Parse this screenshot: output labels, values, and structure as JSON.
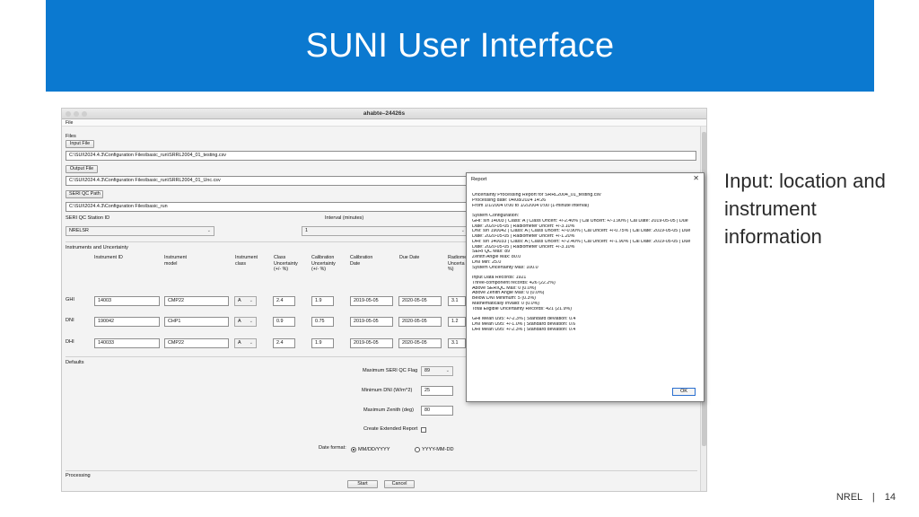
{
  "slide": {
    "title": "SUNI User Interface",
    "side_text": "Input: location and instrument information",
    "footer_org": "NREL",
    "footer_sep": "|",
    "footer_page": "14"
  },
  "app": {
    "window_title": "ahabte–24426s",
    "menu_file": "File",
    "files_section": "Files",
    "input_file_button": "Input File",
    "input_file_path": "C:\\SUI\\2024.4.3\\Configuration Files\\basic_run\\SRRL2004_01_testing.csv",
    "output_file_button": "Output File",
    "output_file_path": "C:\\SUI\\2024.4.3\\Configuration Files\\basic_run\\SRRL2004_01_Unc.csv",
    "seri_qc_path_button": "SERI QC Path",
    "seri_qc_path": "C:\\SUI\\2024.4.3\\Configuration Files\\basic_run",
    "station_label": "SERI QC Station ID",
    "station_value": "NRELSR",
    "interval_label": "Interval (minutes)",
    "interval_value": "1",
    "instruments_section": "Instruments and Uncertainty",
    "columns": {
      "id": "Instrument ID",
      "model_1": "Instrument",
      "model_2": "model",
      "class_1": "Instrument",
      "class_2": "class",
      "cu_1": "Class",
      "cu_2": "Uncertainty",
      "cu_3": "(+/- %)",
      "calu_1": "Calibration",
      "calu_2": "Uncertainty",
      "calu_3": "(+/- %)",
      "cald_1": "Calibration",
      "cald_2": "Date",
      "due": "Due Date",
      "rad_1": "Radiome",
      "rad_2": "Uncerta",
      "rad_3": "%)"
    },
    "rows": [
      {
        "label": "GHI",
        "id": "14003",
        "model": "CMP22",
        "class": "A",
        "class_unc": "2.4",
        "cal_unc": "1.9",
        "cal_date": "2019-05-05",
        "due_date": "2020-05-05",
        "radiometer": "3.1"
      },
      {
        "label": "DNI",
        "id": "190042",
        "model": "CHP1",
        "class": "A",
        "class_unc": "0.9",
        "cal_unc": "0.75",
        "cal_date": "2019-05-05",
        "due_date": "2020-05-05",
        "radiometer": "1.2"
      },
      {
        "label": "DHI",
        "id": "140033",
        "model": "CMP22",
        "class": "A",
        "class_unc": "2.4",
        "cal_unc": "1.9",
        "cal_date": "2019-05-05",
        "due_date": "2020-05-05",
        "radiometer": "3.1"
      }
    ],
    "defaults_section": "Defaults",
    "max_flag_label": "Maximum SERI QC Flag",
    "max_flag_value": "89",
    "min_dni_label": "Minimum DNI (W/m^2)",
    "min_dni_value": "25",
    "max_zenith_label": "Maximum Zenith (deg)",
    "max_zenith_value": "80",
    "extended_report_label": "Create Extended Report",
    "date_format_label": "Date format:",
    "date_format_option1": "MM/DD/YYYY",
    "date_format_option2": "YYYY-MM-DD",
    "processing_section": "Processing",
    "start_button": "Start",
    "cancel_button": "Cancel"
  },
  "report": {
    "title": "Report",
    "close": "✕",
    "lines": [
      "Uncertainty Processing Report for SRRL2004_01_testing.csv",
      "Processing date: 04/08/2024 14:26",
      "From 1/1/2004 0:00 to 1/2/2004 0:00 (1-minute interval)",
      "",
      "System Configuration:",
      "GHI: s/n 14003 | Class: A | Class Uncert: +/-2.40% | Cal Uncert: +/-1.90% | Cal Date: 2019-05-05 | Due",
      "Date: 2020-05-05 | Radiometer Uncert: +/-3.10%",
      "DNI: s/n 190042 | Class: A | Class Uncert: +/-0.90% | Cal Uncert: +/-0.75% | Cal Date: 2019-05-05 | Due",
      "Date: 2020-05-05 | Radiometer Uncert: +/-1.20%",
      "DHI: s/n 140033 | Class: A | Class Uncert: +/-2.40% | Cal Uncert: +/-1.90% | Cal Date: 2019-05-05 | Due",
      "Date: 2020-05-05 | Radiometer Uncert: +/-3.10%",
      "SERI QC Max: 89",
      "Zenith Angle Max: 80.0",
      "DNI Min: 25.0",
      "System Uncertainty Max: 100.0",
      "",
      "Input Data Records: 1921",
      "Three-component records: 426 (22.2%)",
      "Above SERIQC Max: 0 (0.0%)",
      "Above Zenith Angle Max: 0 (0.0%)",
      "Below DNI Minimum: 5 (0.3%)",
      "Mathematically Invalid: 0 (0.0%)",
      "Total Eligible Uncertainty Records: 421 (21.9%)",
      "",
      "GHI Mean U95: +/-2.3% | Standard deviation: 0.4",
      "DNI Mean U95: +/-1.0% | Standard deviation: 0.6",
      "DHI Mean U95: +/-2.3% | Standard deviation: 0.4"
    ],
    "ok_button": "OK"
  }
}
